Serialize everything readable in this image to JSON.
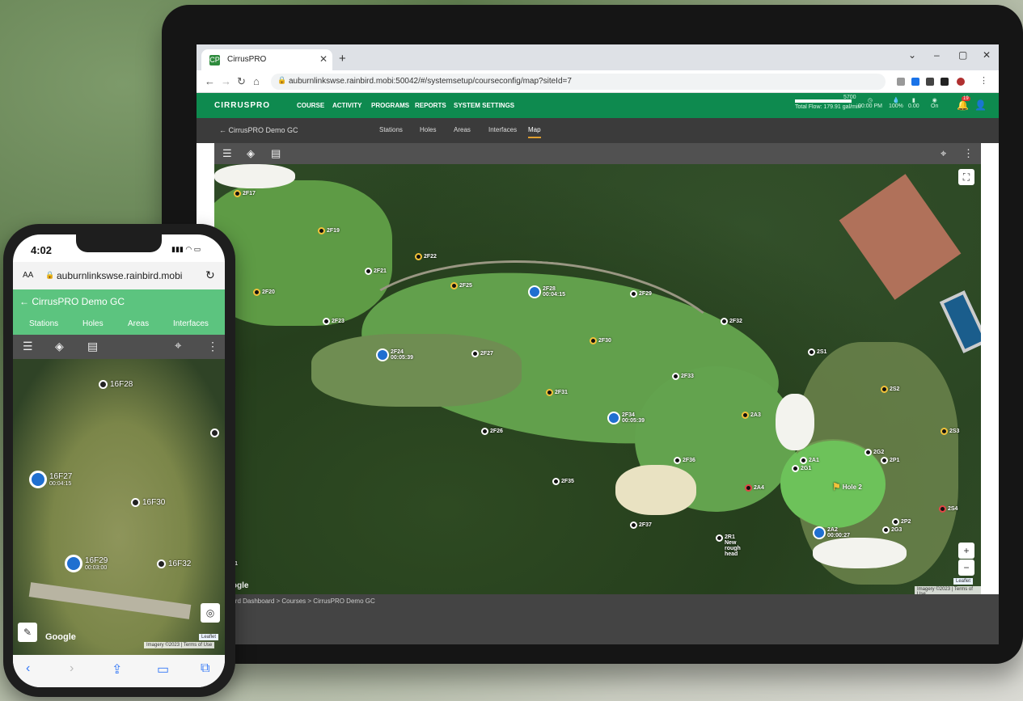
{
  "browser": {
    "tab_title": "CirrusPRO",
    "favicon": "CP",
    "url": "auburnlinkswse.rainbird.mobi:50042/#/systemsetup/courseconfig/map?siteId=7"
  },
  "app": {
    "logo": "CIRRUSPRO",
    "menu": [
      "COURSE",
      "ACTIVITY",
      "PROGRAMS",
      "REPORTS",
      "SYSTEM SETTINGS"
    ],
    "status": {
      "flow_label": "Total Flow: 179.91 gal/min",
      "flow_value": "5700",
      "time": "00:00 PM",
      "pct": "100%",
      "v2": "0.00",
      "on": "On",
      "alert_count": "19"
    }
  },
  "sub": {
    "back_label": "CirrusPRO Demo GC",
    "tabs": [
      "Stations",
      "Holes",
      "Areas",
      "Interfaces",
      "Map"
    ],
    "active_tab": "Map"
  },
  "map": {
    "markers": [
      {
        "id": "2F17",
        "color": "y"
      },
      {
        "id": "2F19",
        "color": "y"
      },
      {
        "id": "2F22",
        "color": "y"
      },
      {
        "id": "2F21",
        "color": "w"
      },
      {
        "id": "2F20",
        "color": "y"
      },
      {
        "id": "2F25",
        "color": "y"
      },
      {
        "id": "2F28",
        "color": "b",
        "sub": "00:04:15"
      },
      {
        "id": "2F29",
        "color": "w"
      },
      {
        "id": "2F23",
        "color": "w"
      },
      {
        "id": "2F32",
        "color": "w"
      },
      {
        "id": "2F24",
        "color": "b",
        "sub": "00:05:39"
      },
      {
        "id": "2F27",
        "color": "w"
      },
      {
        "id": "2F30",
        "color": "y"
      },
      {
        "id": "2S1",
        "color": "w"
      },
      {
        "id": "2F33",
        "color": "w"
      },
      {
        "id": "2S2",
        "color": "y"
      },
      {
        "id": "2F31",
        "color": "y"
      },
      {
        "id": "2F34",
        "color": "b",
        "sub": "00:05:39"
      },
      {
        "id": "2A3",
        "color": "y"
      },
      {
        "id": "2F26",
        "color": "w"
      },
      {
        "id": "2S3",
        "color": "y"
      },
      {
        "id": "2F36",
        "color": "w"
      },
      {
        "id": "2A1",
        "color": "w"
      },
      {
        "id": "2G1",
        "color": "w"
      },
      {
        "id": "2G2",
        "color": "w"
      },
      {
        "id": "2P1",
        "color": "w"
      },
      {
        "id": "2F35",
        "color": "w"
      },
      {
        "id": "2A4",
        "color": "r"
      },
      {
        "id": "2S4",
        "color": "r"
      },
      {
        "id": "2F37",
        "color": "w"
      },
      {
        "id": "2P2",
        "color": "w"
      },
      {
        "id": "2G3",
        "color": "w"
      },
      {
        "id": "2A2",
        "color": "b",
        "sub": "00:00:27"
      },
      {
        "id": "2R1",
        "color": "w",
        "sub": "New rough head"
      },
      {
        "id": "1T1",
        "color": "r"
      }
    ],
    "hole_label": "Hole 2",
    "google": "Google",
    "attribution": "Imagery ©2023 | Terms of Use",
    "leaflet": "Leaflet"
  },
  "breadcrumb": "Rain Bird Dashboard > Courses > CirrusPRO Demo GC",
  "phone": {
    "time": "4:02",
    "url": "auburnlinkswse.rainbird.mobi",
    "url_prefix": "AA",
    "back_label": "CirrusPRO Demo GC",
    "tabs": [
      "Stations",
      "Holes",
      "Areas",
      "Interfaces"
    ],
    "markers": [
      {
        "id": "16F28"
      },
      {
        "id": "16F27",
        "sub": "00:04:15",
        "b": true
      },
      {
        "id": "16F30"
      },
      {
        "id": "16F29",
        "sub": "00:03:00",
        "b": true
      },
      {
        "id": "16F32"
      }
    ],
    "google": "Google",
    "attribution": "Imagery ©2023 | Terms of Use",
    "leaflet": "Leaflet"
  }
}
